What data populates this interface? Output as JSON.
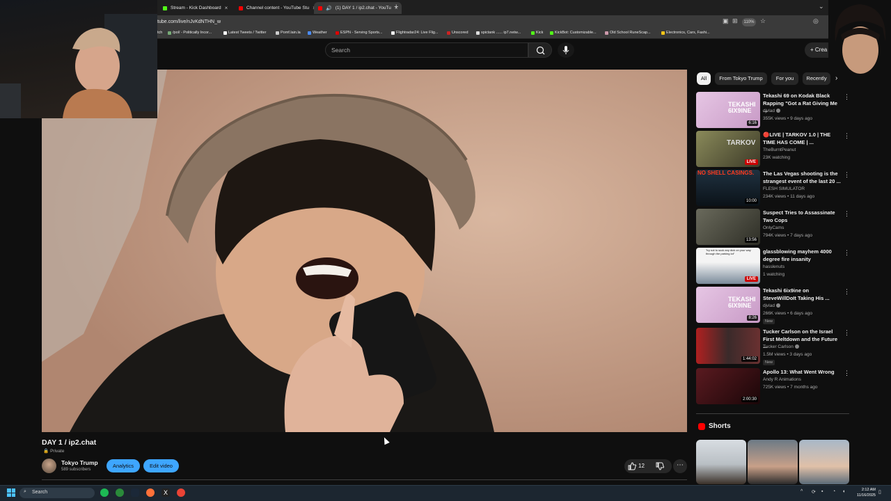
{
  "browser": {
    "tabs": [
      {
        "label": "Stream - Kick Dashboard",
        "color": "#53fc18"
      },
      {
        "label": "Channel content - YouTube Stu",
        "color": "#ff0000"
      },
      {
        "label": "(1) DAY 1 / ip2.chat - YouTu",
        "color": "#ff0000",
        "active": true
      }
    ],
    "url": "tube.com/live/nJvKdNTHN_w",
    "zoom": "110%",
    "bookmarks": [
      "tch",
      "/pol/ - Politically Incor...",
      "Latest Tweets / Twitter",
      "Pomf.lain.la",
      "Weather",
      "ESPN - Serving Sports...",
      "Flightradar24: Live Flig...",
      "Unscored",
      "spictank ...... ip7.netw...",
      "Kick",
      "KickBot: Customizable...",
      "Old School RuneScap...",
      "Electronics, Cars, Fashi..."
    ]
  },
  "header": {
    "search_placeholder": "Search",
    "create_label": "Crea"
  },
  "video": {
    "title": "DAY 1 / ip2.chat",
    "privacy": "Private",
    "channel_name": "Tokyo Trump",
    "subscribers": "589 subscribers",
    "analytics_label": "Analytics",
    "edit_label": "Edit video",
    "likes": "12",
    "more": "⋯"
  },
  "chips": [
    "All",
    "From Tokyo Trump",
    "For you",
    "Recently"
  ],
  "recommendations": [
    {
      "title": "Tekashi 69 on Kodak Black Rapping \"Got a Rat Giving Me ...",
      "channel": "djvlad",
      "verified": true,
      "meta": "355K views • 9 days ago",
      "duration": "6:16",
      "thumb": "#d9b4d6",
      "text": "TEKASHI 6IX9INE"
    },
    {
      "title": "🔴LIVE | TARKOV 1.0 | THE TIME HAS COME | ...",
      "channel": "TheBurntPeanut",
      "verified": false,
      "meta": "23K watching",
      "live": "LIVE",
      "thumb": "#6b6a4a",
      "text": "TARKOV"
    },
    {
      "title": "The Las Vegas shooting is the strangest event of the last 20 ...",
      "channel": "FLESH SIMULATOR",
      "verified": false,
      "meta": "234K views • 11 days ago",
      "duration": "10:00",
      "thumb": "#1b2a35",
      "text": "NO SHELL CASINGS."
    },
    {
      "title": "Suspect Tries to Assassinate Two Cops",
      "channel": "OnlyCams",
      "verified": false,
      "meta": "794K views • 7 days ago",
      "duration": "13:56",
      "thumb": "#4a4a40",
      "text": ""
    },
    {
      "title": "glassblowing mayhem 4000 degree fire insanity",
      "channel": "hasslenuts",
      "verified": false,
      "meta": "1 watching",
      "live": "LIVE",
      "thumb": "#e8e8e8",
      "text": "\"try not to suck any dick on your way through the parking lot\""
    },
    {
      "title": "Tekashi 6ix9ine on SteveWillDoIt Taking His ...",
      "channel": "djvlad",
      "verified": true,
      "meta": "266K views • 6 days ago",
      "badge": "New",
      "duration": "8:26",
      "thumb": "#d9b4d6",
      "text": "TEKASHI 6IX9INE"
    },
    {
      "title": "Tucker Carlson on the Israel First Meltdown and the Future ...",
      "channel": "Tucker Carlson",
      "verified": true,
      "meta": "1.5M views • 3 days ago",
      "badge": "New",
      "duration": "1:44:02",
      "thumb": "#2a1e1e",
      "text": ""
    },
    {
      "title": "Apollo 13: What Went Wrong",
      "channel": "Andy R Animations",
      "verified": false,
      "meta": "725K views • 7 months ago",
      "duration": "2:00:30",
      "thumb": "#3a1418",
      "text": ""
    }
  ],
  "shorts": {
    "label": "Shorts"
  },
  "taskbar": {
    "search": "Search",
    "time": "2:12 AM",
    "date": "11/16/2025"
  }
}
